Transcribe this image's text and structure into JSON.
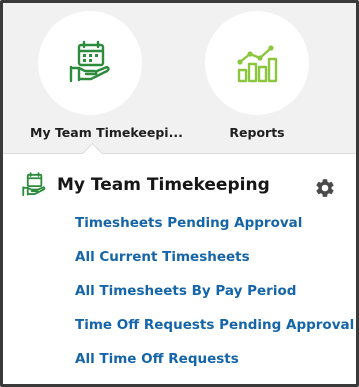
{
  "tiles": [
    {
      "label": "My Team Timekeepi...",
      "icon": "timekeeping-hand-calendar-icon",
      "color": "#2e8b3d"
    },
    {
      "label": "Reports",
      "icon": "bar-chart-trend-icon",
      "color": "#8cc63f"
    }
  ],
  "panel": {
    "title": "My Team Timekeeping",
    "header_icon": "timekeeping-hand-calendar-icon",
    "settings_icon": "gear-icon",
    "links": [
      "Timesheets Pending Approval",
      "All Current Timesheets",
      "All Timesheets By Pay Period",
      "Time Off Requests Pending Approval",
      "All Time Off Requests"
    ]
  },
  "colors": {
    "link": "#1665a8",
    "accent_green": "#2e8b3d",
    "reports_green": "#8cc63f"
  }
}
